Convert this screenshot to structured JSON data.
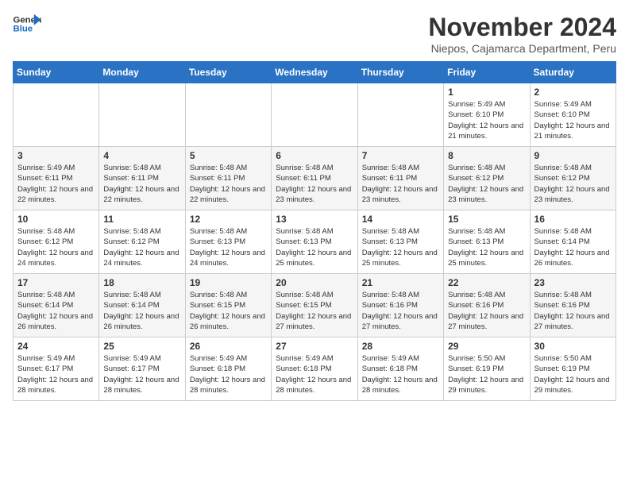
{
  "logo": {
    "line1": "General",
    "line2": "Blue"
  },
  "title": "November 2024",
  "subtitle": "Niepos, Cajamarca Department, Peru",
  "days_of_week": [
    "Sunday",
    "Monday",
    "Tuesday",
    "Wednesday",
    "Thursday",
    "Friday",
    "Saturday"
  ],
  "weeks": [
    [
      {
        "day": "",
        "info": ""
      },
      {
        "day": "",
        "info": ""
      },
      {
        "day": "",
        "info": ""
      },
      {
        "day": "",
        "info": ""
      },
      {
        "day": "",
        "info": ""
      },
      {
        "day": "1",
        "info": "Sunrise: 5:49 AM\nSunset: 6:10 PM\nDaylight: 12 hours and 21 minutes."
      },
      {
        "day": "2",
        "info": "Sunrise: 5:49 AM\nSunset: 6:10 PM\nDaylight: 12 hours and 21 minutes."
      }
    ],
    [
      {
        "day": "3",
        "info": "Sunrise: 5:49 AM\nSunset: 6:11 PM\nDaylight: 12 hours and 22 minutes."
      },
      {
        "day": "4",
        "info": "Sunrise: 5:48 AM\nSunset: 6:11 PM\nDaylight: 12 hours and 22 minutes."
      },
      {
        "day": "5",
        "info": "Sunrise: 5:48 AM\nSunset: 6:11 PM\nDaylight: 12 hours and 22 minutes."
      },
      {
        "day": "6",
        "info": "Sunrise: 5:48 AM\nSunset: 6:11 PM\nDaylight: 12 hours and 23 minutes."
      },
      {
        "day": "7",
        "info": "Sunrise: 5:48 AM\nSunset: 6:11 PM\nDaylight: 12 hours and 23 minutes."
      },
      {
        "day": "8",
        "info": "Sunrise: 5:48 AM\nSunset: 6:12 PM\nDaylight: 12 hours and 23 minutes."
      },
      {
        "day": "9",
        "info": "Sunrise: 5:48 AM\nSunset: 6:12 PM\nDaylight: 12 hours and 23 minutes."
      }
    ],
    [
      {
        "day": "10",
        "info": "Sunrise: 5:48 AM\nSunset: 6:12 PM\nDaylight: 12 hours and 24 minutes."
      },
      {
        "day": "11",
        "info": "Sunrise: 5:48 AM\nSunset: 6:12 PM\nDaylight: 12 hours and 24 minutes."
      },
      {
        "day": "12",
        "info": "Sunrise: 5:48 AM\nSunset: 6:13 PM\nDaylight: 12 hours and 24 minutes."
      },
      {
        "day": "13",
        "info": "Sunrise: 5:48 AM\nSunset: 6:13 PM\nDaylight: 12 hours and 25 minutes."
      },
      {
        "day": "14",
        "info": "Sunrise: 5:48 AM\nSunset: 6:13 PM\nDaylight: 12 hours and 25 minutes."
      },
      {
        "day": "15",
        "info": "Sunrise: 5:48 AM\nSunset: 6:13 PM\nDaylight: 12 hours and 25 minutes."
      },
      {
        "day": "16",
        "info": "Sunrise: 5:48 AM\nSunset: 6:14 PM\nDaylight: 12 hours and 26 minutes."
      }
    ],
    [
      {
        "day": "17",
        "info": "Sunrise: 5:48 AM\nSunset: 6:14 PM\nDaylight: 12 hours and 26 minutes."
      },
      {
        "day": "18",
        "info": "Sunrise: 5:48 AM\nSunset: 6:14 PM\nDaylight: 12 hours and 26 minutes."
      },
      {
        "day": "19",
        "info": "Sunrise: 5:48 AM\nSunset: 6:15 PM\nDaylight: 12 hours and 26 minutes."
      },
      {
        "day": "20",
        "info": "Sunrise: 5:48 AM\nSunset: 6:15 PM\nDaylight: 12 hours and 27 minutes."
      },
      {
        "day": "21",
        "info": "Sunrise: 5:48 AM\nSunset: 6:16 PM\nDaylight: 12 hours and 27 minutes."
      },
      {
        "day": "22",
        "info": "Sunrise: 5:48 AM\nSunset: 6:16 PM\nDaylight: 12 hours and 27 minutes."
      },
      {
        "day": "23",
        "info": "Sunrise: 5:48 AM\nSunset: 6:16 PM\nDaylight: 12 hours and 27 minutes."
      }
    ],
    [
      {
        "day": "24",
        "info": "Sunrise: 5:49 AM\nSunset: 6:17 PM\nDaylight: 12 hours and 28 minutes."
      },
      {
        "day": "25",
        "info": "Sunrise: 5:49 AM\nSunset: 6:17 PM\nDaylight: 12 hours and 28 minutes."
      },
      {
        "day": "26",
        "info": "Sunrise: 5:49 AM\nSunset: 6:18 PM\nDaylight: 12 hours and 28 minutes."
      },
      {
        "day": "27",
        "info": "Sunrise: 5:49 AM\nSunset: 6:18 PM\nDaylight: 12 hours and 28 minutes."
      },
      {
        "day": "28",
        "info": "Sunrise: 5:49 AM\nSunset: 6:18 PM\nDaylight: 12 hours and 28 minutes."
      },
      {
        "day": "29",
        "info": "Sunrise: 5:50 AM\nSunset: 6:19 PM\nDaylight: 12 hours and 29 minutes."
      },
      {
        "day": "30",
        "info": "Sunrise: 5:50 AM\nSunset: 6:19 PM\nDaylight: 12 hours and 29 minutes."
      }
    ]
  ]
}
